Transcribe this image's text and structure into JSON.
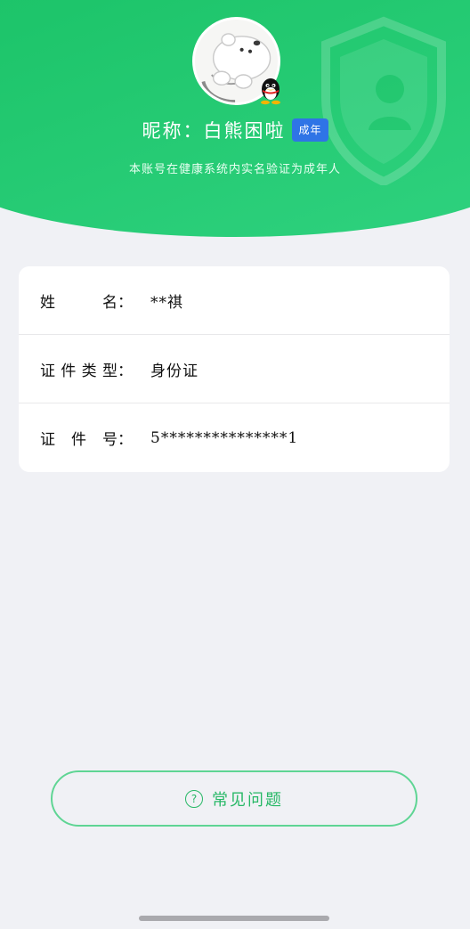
{
  "header": {
    "nickname": "昵称：白熊困啦",
    "adult_badge": "成年",
    "verify_note": "本账号在健康系统内实名验证为成年人"
  },
  "identity": {
    "rows": [
      {
        "label_chars": [
          "姓",
          "名："
        ],
        "value": "**祺"
      },
      {
        "label_chars": [
          "证",
          "件",
          "类",
          "型："
        ],
        "value": "身份证"
      },
      {
        "label_chars": [
          "证",
          "件",
          "号："
        ],
        "value": "5***************1"
      }
    ]
  },
  "faq": {
    "icon_glyph": "?",
    "label": "常见问题"
  },
  "colors": {
    "brand_green": "#1ec56b",
    "badge_blue": "#2f74e6",
    "faq_text": "#27b866"
  },
  "icons": {
    "avatar": "polar-bear-avatar",
    "platform": "qq-penguin-icon",
    "header_decoration": "shield-icon",
    "faq": "question-circle-icon"
  }
}
